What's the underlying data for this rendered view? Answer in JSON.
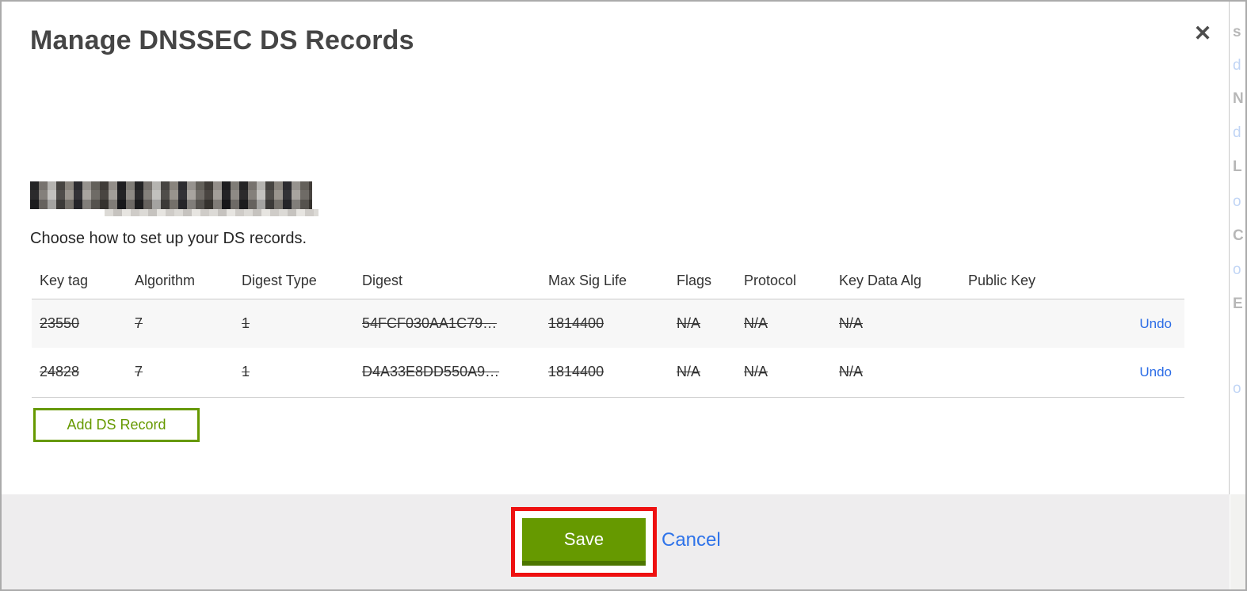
{
  "modal": {
    "title": "Manage DNSSEC DS Records",
    "close_icon": "✕",
    "domain_name_redacted": "(pixelated domain name)",
    "subtitle": "Choose how to set up your DS records.",
    "table": {
      "headers": [
        "Key tag",
        "Algorithm",
        "Digest Type",
        "Digest",
        "Max Sig Life",
        "Flags",
        "Protocol",
        "Key Data Alg",
        "Public Key"
      ],
      "rows": [
        {
          "key_tag": "23550",
          "algorithm": "7",
          "digest_type": "1",
          "digest": "54FCF030AA1C79…",
          "max_sig_life": "1814400",
          "flags": "N/A",
          "protocol": "N/A",
          "key_data_alg": "N/A",
          "public_key": "",
          "action": "Undo",
          "state": "marked-for-deletion"
        },
        {
          "key_tag": "24828",
          "algorithm": "7",
          "digest_type": "1",
          "digest": "D4A33E8DD550A9…",
          "max_sig_life": "1814400",
          "flags": "N/A",
          "protocol": "N/A",
          "key_data_alg": "N/A",
          "public_key": "",
          "action": "Undo",
          "state": "marked-for-deletion"
        }
      ]
    },
    "add_button_label": "Add DS Record",
    "footer": {
      "save_label": "Save",
      "cancel_label": "Cancel"
    }
  },
  "annotation": {
    "type": "red-highlight-box",
    "target": "save-button"
  },
  "colors": {
    "accent_green": "#669900",
    "accent_green_dark": "#4c7600",
    "annotation_red": "#ee1111",
    "link_blue": "#2e73e9",
    "footer_gray": "#eeedee",
    "row_stripe": "#f7f7f7"
  },
  "background_edge": {
    "glyphs": [
      {
        "t": "s"
      },
      {
        "t": "d"
      },
      {
        "t": "N"
      },
      {
        "t": "d"
      },
      {
        "t": "L"
      },
      {
        "t": "o"
      },
      {
        "t": "C"
      },
      {
        "t": "o"
      },
      {
        "t": "E"
      },
      {
        "t": "o"
      }
    ]
  }
}
